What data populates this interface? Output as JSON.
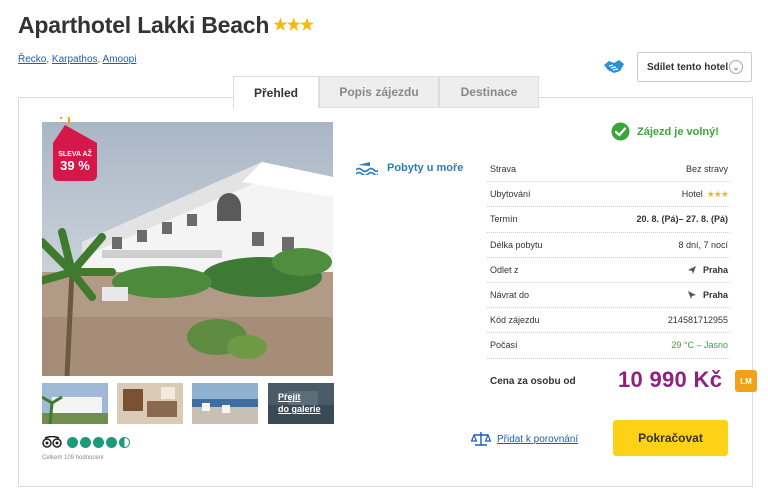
{
  "hotel": {
    "name": "Aparthotel Lakki Beach",
    "stars": "★★★"
  },
  "breadcrumb": [
    "Řecko",
    "Karpathos",
    "Amoopi"
  ],
  "share": {
    "label": "Sdílet tento hotel",
    "chevron": "⌄"
  },
  "tabs": [
    "Přehled",
    "Popis zájezdu",
    "Destinace"
  ],
  "discount": {
    "label": "SLEVA AŽ",
    "value": "39 %",
    "color": "#d6174a"
  },
  "gallery": {
    "link_label_1": "Přejít",
    "link_label_2": "do galerie"
  },
  "tripadvisor": {
    "rating": 4.5,
    "max": 5,
    "reviews": "Celkem 109 hodnocení",
    "color": "#1c9a7b"
  },
  "category": "Pobyty u moře",
  "availability": "Zájezd je volný!",
  "details": [
    {
      "key": "Strava",
      "value": "Bez stravy"
    },
    {
      "key": "Ubytování",
      "value": "Hotel",
      "stars": "★★★"
    },
    {
      "key": "Termín",
      "value": "20. 8. (Pá)– 27. 8. (Pá)"
    },
    {
      "key": "Délka pobytu",
      "value": "8 dní, 7 nocí"
    },
    {
      "key": "Odlet z",
      "value": "Praha",
      "icon": "plane-icon"
    },
    {
      "key": "Návrat do",
      "value": "Praha",
      "icon": "plane-icon"
    },
    {
      "key": "Kód zájezdu",
      "value": "214581712955"
    },
    {
      "key": "Počasí",
      "value": "29 °C – Jasno"
    }
  ],
  "price": {
    "label": "Cena za osobu od",
    "value": "10 990 Kč",
    "badge": "LM",
    "color": "#8e2080"
  },
  "compare": {
    "label": "Přidat k porovnání"
  },
  "cta": {
    "label": "Pokračovat",
    "color": "#fcd116"
  }
}
